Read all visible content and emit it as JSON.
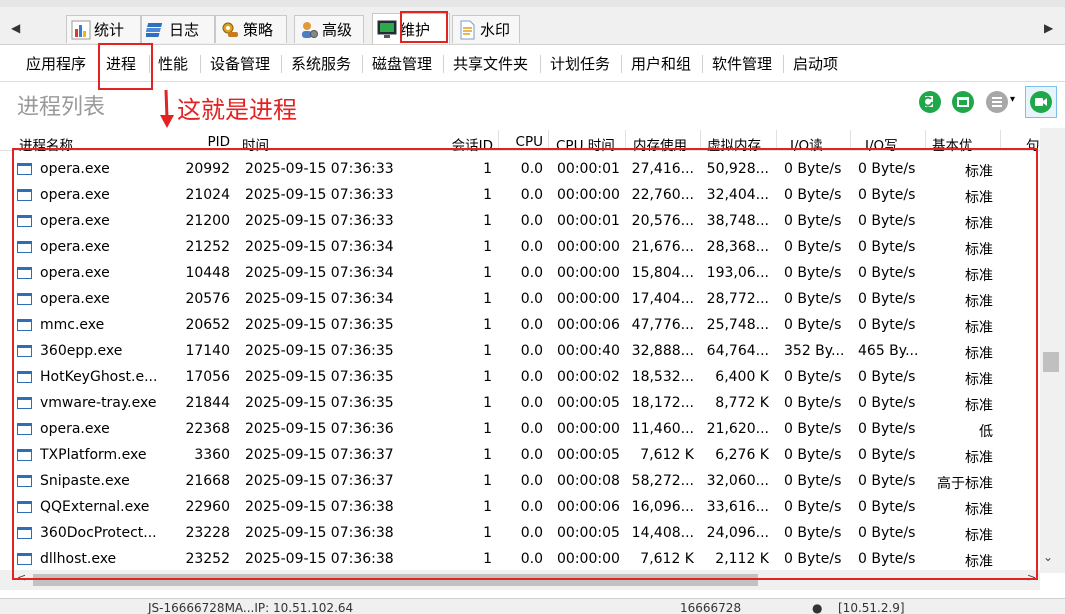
{
  "tabs": [
    {
      "label": "统计",
      "icon": "bar-chart-icon"
    },
    {
      "label": "日志",
      "icon": "book-stack-icon"
    },
    {
      "label": "策略",
      "icon": "gear-hand-icon"
    },
    {
      "label": "高级",
      "icon": "user-gear-icon"
    },
    {
      "label": "维护",
      "icon": "monitor-icon",
      "active": true
    },
    {
      "label": "水印",
      "icon": "document-icon"
    }
  ],
  "subtabs": [
    "应用程序",
    "进程",
    "性能",
    "设备管理",
    "系统服务",
    "磁盘管理",
    "共享文件夹",
    "计划任务",
    "用户和组",
    "软件管理",
    "启动项"
  ],
  "list_title": "进程列表",
  "annotation": "这就是进程",
  "columns": [
    "进程名称",
    "PID",
    "时间",
    "会话ID",
    "CPU",
    "CPU 时间",
    "内存使用",
    "虚拟内存",
    "I/O读...",
    "I/O写...",
    "基本优...",
    "句"
  ],
  "rows": [
    [
      "opera.exe",
      "20992",
      "2025-09-15 07:36:33",
      "1",
      "0.0",
      "00:00:01",
      "27,416...",
      "50,928...",
      "0 Byte/s",
      "0 Byte/s",
      "标准"
    ],
    [
      "opera.exe",
      "21024",
      "2025-09-15 07:36:33",
      "1",
      "0.0",
      "00:00:00",
      "22,760...",
      "32,404...",
      "0 Byte/s",
      "0 Byte/s",
      "标准"
    ],
    [
      "opera.exe",
      "21200",
      "2025-09-15 07:36:33",
      "1",
      "0.0",
      "00:00:01",
      "20,576...",
      "38,748...",
      "0 Byte/s",
      "0 Byte/s",
      "标准"
    ],
    [
      "opera.exe",
      "21252",
      "2025-09-15 07:36:34",
      "1",
      "0.0",
      "00:00:00",
      "21,676...",
      "28,368...",
      "0 Byte/s",
      "0 Byte/s",
      "标准"
    ],
    [
      "opera.exe",
      "10448",
      "2025-09-15 07:36:34",
      "1",
      "0.0",
      "00:00:00",
      "15,804...",
      "193,06...",
      "0 Byte/s",
      "0 Byte/s",
      "标准"
    ],
    [
      "opera.exe",
      "20576",
      "2025-09-15 07:36:34",
      "1",
      "0.0",
      "00:00:00",
      "17,404...",
      "28,772...",
      "0 Byte/s",
      "0 Byte/s",
      "标准"
    ],
    [
      "mmc.exe",
      "20652",
      "2025-09-15 07:36:35",
      "1",
      "0.0",
      "00:00:06",
      "47,776...",
      "25,748...",
      "0 Byte/s",
      "0 Byte/s",
      "标准"
    ],
    [
      "360epp.exe",
      "17140",
      "2025-09-15 07:36:35",
      "1",
      "0.0",
      "00:00:40",
      "32,888...",
      "64,764...",
      "352 By...",
      "465 By...",
      "标准"
    ],
    [
      "HotKeyGhost.e...",
      "17056",
      "2025-09-15 07:36:35",
      "1",
      "0.0",
      "00:00:02",
      "18,532...",
      "6,400 K",
      "0 Byte/s",
      "0 Byte/s",
      "标准"
    ],
    [
      "vmware-tray.exe",
      "21844",
      "2025-09-15 07:36:35",
      "1",
      "0.0",
      "00:00:05",
      "18,172...",
      "8,772 K",
      "0 Byte/s",
      "0 Byte/s",
      "标准"
    ],
    [
      "opera.exe",
      "22368",
      "2025-09-15 07:36:36",
      "1",
      "0.0",
      "00:00:00",
      "11,460...",
      "21,620...",
      "0 Byte/s",
      "0 Byte/s",
      "低"
    ],
    [
      "TXPlatform.exe",
      "3360",
      "2025-09-15 07:36:37",
      "1",
      "0.0",
      "00:00:05",
      "7,612 K",
      "6,276 K",
      "0 Byte/s",
      "0 Byte/s",
      "标准"
    ],
    [
      "Snipaste.exe",
      "21668",
      "2025-09-15 07:36:37",
      "1",
      "0.0",
      "00:00:08",
      "58,272...",
      "32,060...",
      "0 Byte/s",
      "0 Byte/s",
      "高于标准"
    ],
    [
      "QQExternal.exe",
      "22960",
      "2025-09-15 07:36:38",
      "1",
      "0.0",
      "00:00:06",
      "16,096...",
      "33,616...",
      "0 Byte/s",
      "0 Byte/s",
      "标准"
    ],
    [
      "360DocProtect...",
      "23228",
      "2025-09-15 07:36:38",
      "1",
      "0.0",
      "00:00:05",
      "14,408...",
      "24,096...",
      "0 Byte/s",
      "0 Byte/s",
      "标准"
    ],
    [
      "dllhost.exe",
      "23252",
      "2025-09-15 07:36:38",
      "1",
      "0.0",
      "00:00:00",
      "7,612 K",
      "2,112 K",
      "0 Byte/s",
      "0 Byte/s",
      "标准"
    ]
  ],
  "status": [
    "JS-16666728MA...IP: 10.51.102.64",
    "16666728",
    "[10.51.2.9]"
  ],
  "colors": {
    "accent_red": "#e32222",
    "green_button": "#1fa84a",
    "title_gray": "#9a9a9a"
  }
}
